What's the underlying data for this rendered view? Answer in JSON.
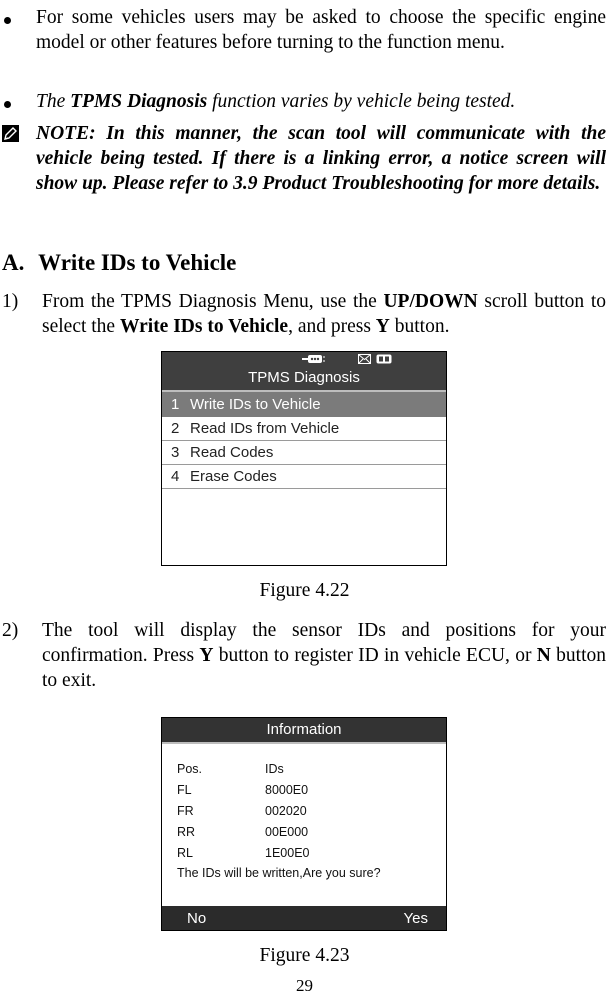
{
  "bullets": [
    {
      "text": "For some vehicles users may be asked to choose the specific engine model or other features before turning to the function menu."
    },
    {
      "pre": "The ",
      "bold": "TPMS Diagnosis",
      "post": " function varies by vehicle being tested."
    }
  ],
  "note": {
    "icon": "pencil-note-icon",
    "text": "NOTE: In this manner, the scan tool will communicate with the vehicle being tested. If there is a linking error, a notice screen will show up. Please refer to 3.9 Product Troubleshooting for more details."
  },
  "section": {
    "label": "A.",
    "title": "Write IDs to Vehicle"
  },
  "steps": [
    {
      "num": "1)",
      "parts": [
        "From the TPMS Diagnosis Menu, use the ",
        "UP/DOWN",
        " scroll button to select the ",
        "Write IDs to Vehicle",
        ", and press ",
        "Y",
        " button."
      ]
    },
    {
      "num": "2)",
      "parts": [
        "The tool will display the sensor IDs and positions for your confirmation. Press ",
        "Y",
        " button to register ID in vehicle ECU, or ",
        "N",
        " button to exit."
      ]
    }
  ],
  "figure1": {
    "caption": "Figure 4.22",
    "status_icons": [
      "obd-connector-icon",
      "message-icon",
      "battery-icon"
    ],
    "title": "TPMS Diagnosis",
    "items": [
      {
        "num": "1",
        "label": "Write IDs to Vehicle",
        "selected": true
      },
      {
        "num": "2",
        "label": "Read IDs from Vehicle",
        "selected": false
      },
      {
        "num": "3",
        "label": "Read Codes",
        "selected": false
      },
      {
        "num": "4",
        "label": "Erase Codes",
        "selected": false
      }
    ]
  },
  "figure2": {
    "caption": "Figure 4.23",
    "title": "Information",
    "header": {
      "pos": "Pos.",
      "ids": "IDs"
    },
    "rows": [
      {
        "pos": "FL",
        "id": "8000E0"
      },
      {
        "pos": "FR",
        "id": "002020"
      },
      {
        "pos": "RR",
        "id": "00E000"
      },
      {
        "pos": "RL",
        "id": "1E00E0"
      }
    ],
    "message": "The IDs will be written,Are you sure?",
    "no_label": "No",
    "yes_label": "Yes"
  },
  "page_number": "29"
}
